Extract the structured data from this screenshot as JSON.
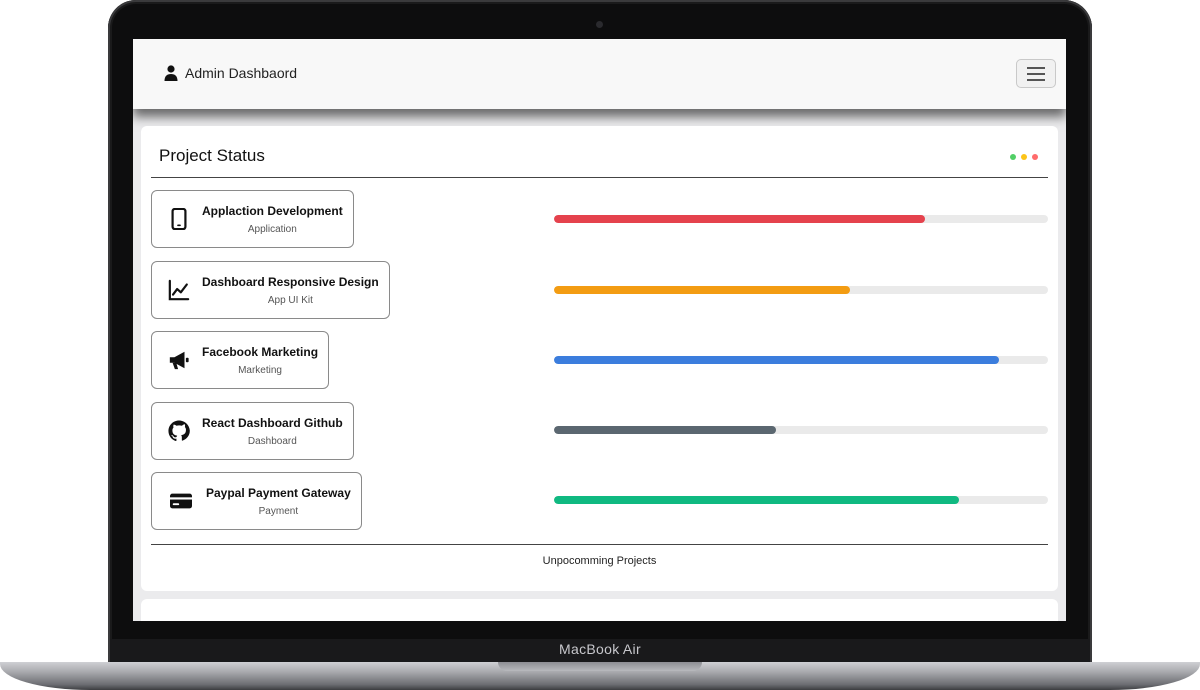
{
  "device": {
    "brand_label": "MacBook Air"
  },
  "navbar": {
    "brand_text": "Admin Dashbaord",
    "brand_icon": "user-icon",
    "toggler_icon": "hamburger-icon"
  },
  "card": {
    "title": "Project Status",
    "status_dots": [
      "#51cf66",
      "#fcc419",
      "#ff6b6b"
    ],
    "footer_link": "Unpocomming Projects",
    "projects": [
      {
        "name": "Applaction Development",
        "category": "Application",
        "icon": "mobile-phone-icon",
        "progress": 0.75,
        "color": "#e5424d"
      },
      {
        "name": "Dashboard Responsive Design",
        "category": "App UI Kit",
        "icon": "line-chart-icon",
        "progress": 0.6,
        "color": "#f39c12"
      },
      {
        "name": "Facebook Marketing",
        "category": "Marketing",
        "icon": "megaphone-icon",
        "progress": 0.9,
        "color": "#3b7ddd"
      },
      {
        "name": "React Dashboard Github",
        "category": "Dashboard",
        "icon": "github-icon",
        "progress": 0.45,
        "color": "#5b6770"
      },
      {
        "name": "Paypal Payment Gateway",
        "category": "Payment",
        "icon": "credit-card-icon",
        "progress": 0.82,
        "color": "#10b981"
      }
    ]
  }
}
